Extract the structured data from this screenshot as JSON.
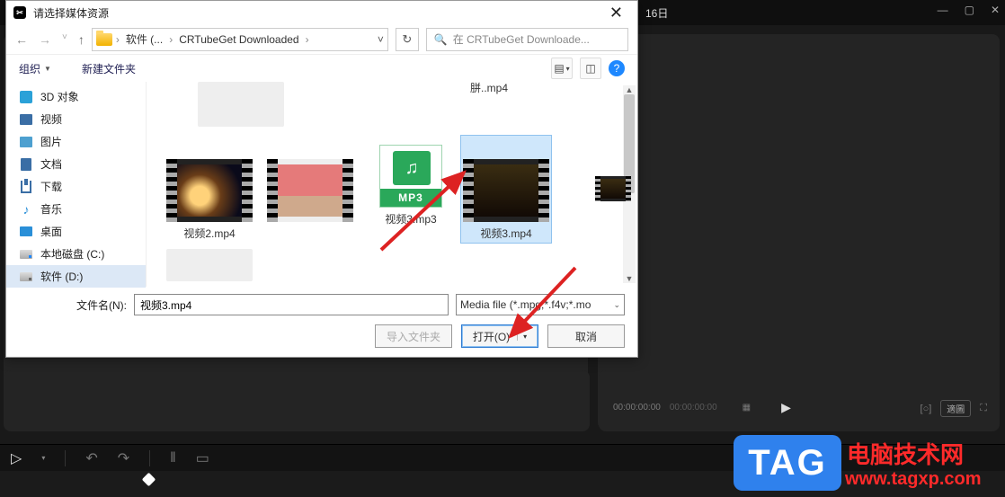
{
  "app": {
    "date_fragment": "16日",
    "window_icons": {
      "min": "—",
      "max": "▢",
      "close": "✕"
    }
  },
  "player": {
    "time_current": "00:00:00:00",
    "time_total": "00:00:00:00",
    "ratio_label": "適圖"
  },
  "toolbar": {
    "cursor": "▷",
    "undo": "↶",
    "redo": "↷",
    "split": "‖",
    "delete": "▭"
  },
  "tag": {
    "badge": "TAG",
    "line1": "电脑技术网",
    "line2": "www.tagxp.com"
  },
  "dialog": {
    "title": "请选择媒体资源",
    "close": "✕",
    "nav": {
      "back": "←",
      "fwd": "→",
      "recent": "˅",
      "up": "↑"
    },
    "breadcrumbs": {
      "a": "软件 (...",
      "b": "CRTubeGet Downloaded"
    },
    "search_placeholder": "在 CRTubeGet Downloade...",
    "organize": "组织",
    "newfolder": "新建文件夹",
    "top_fragment": "胼..mp4",
    "sidebar": [
      {
        "icon": "cube3d",
        "label": "3D 对象"
      },
      {
        "icon": "film",
        "label": "视频"
      },
      {
        "icon": "pic",
        "label": "图片"
      },
      {
        "icon": "docx",
        "label": "文档"
      },
      {
        "icon": "dl",
        "label": "下载"
      },
      {
        "icon": "note",
        "label": "音乐"
      },
      {
        "icon": "desk",
        "label": "桌面"
      },
      {
        "icon": "drive c",
        "label": "本地磁盘 (C:)"
      },
      {
        "icon": "drive d",
        "label": "软件 (D:)",
        "selected": true
      }
    ],
    "files": {
      "video2": "视频2.mp4",
      "video3mp3": "视频3.mp3",
      "video3mp4": "视频3.mp4",
      "mp3_badge": "MP3"
    },
    "filename_label": "文件名(N):",
    "filename_value": "视频3.mp4",
    "filetype_value": "Media file (*.mpg;*.f4v;*.mo",
    "buttons": {
      "import_folder": "导入文件夹",
      "open": "打开(O)",
      "cancel": "取消"
    }
  }
}
